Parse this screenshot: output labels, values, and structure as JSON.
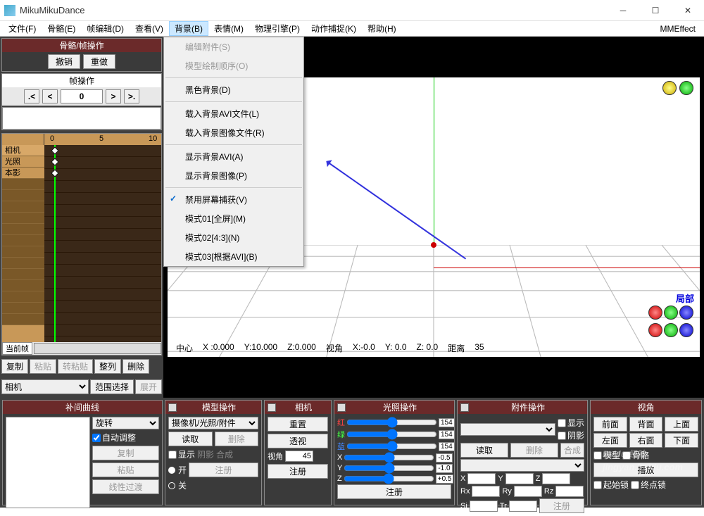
{
  "window": {
    "title": "MikuMikuDance"
  },
  "menubar": {
    "items": [
      "文件(F)",
      "骨骼(E)",
      "帧编辑(D)",
      "查看(V)",
      "背景(B)",
      "表情(M)",
      "物理引擎(P)",
      "动作捕捉(K)",
      "帮助(H)"
    ],
    "active_index": 4,
    "right": "MMEffect"
  },
  "dropdown": {
    "items": [
      {
        "label": "编辑附件(S)",
        "disabled": true
      },
      {
        "label": "模型绘制顺序(O)",
        "disabled": true
      },
      {
        "sep": true
      },
      {
        "label": "黑色背景(D)"
      },
      {
        "sep": true
      },
      {
        "label": "载入背景AVI文件(L)"
      },
      {
        "label": "载入背景图像文件(R)"
      },
      {
        "sep": true
      },
      {
        "label": "显示背景AVI(A)"
      },
      {
        "label": "显示背景图像(P)"
      },
      {
        "sep": true
      },
      {
        "label": "禁用屏幕捕获(V)",
        "checked": true
      },
      {
        "label": "模式01[全屏](M)"
      },
      {
        "label": "模式02[4:3](N)"
      },
      {
        "label": "模式03[根据AVI](B)"
      }
    ]
  },
  "bone_panel": {
    "title": "骨骼/帧操作",
    "undo": "撤销",
    "redo": "重做"
  },
  "frame_panel": {
    "title": "帧操作",
    "value": "0",
    "first": "|<",
    "prev": "<",
    "next": ">",
    "last": ">|"
  },
  "timeline": {
    "ruler": [
      "0",
      "5",
      "10"
    ],
    "tracks": [
      "相机",
      "光照",
      "本影"
    ],
    "current_label": "当前帧"
  },
  "ops": {
    "copy": "复制",
    "paste": "粘贴",
    "paste_rev": "转粘贴",
    "align": "整列",
    "delete": "删除",
    "model_select": "相机",
    "range": "范围选择",
    "expand": "展开"
  },
  "viewport": {
    "info": {
      "center": "中心",
      "x": "X :0.000",
      "y": "Y:10.000",
      "z": "Z:0.000",
      "view": "视角",
      "vx": "X:-0.0",
      "vy": "Y: 0.0",
      "vz": "Z: 0.0",
      "dist": "距离",
      "dval": "35"
    },
    "local": "局部"
  },
  "bottom": {
    "curve": {
      "title": "补间曲线",
      "mode": "旋转",
      "auto": "自动调整",
      "copy": "复制",
      "paste": "粘贴",
      "linear": "线性过渡"
    },
    "model": {
      "title": "模型操作",
      "select": "摄像机/光照/附件",
      "read": "读取",
      "delete": "删除",
      "show": "显示",
      "shadow": "阴影",
      "compose": "合成",
      "on": "开",
      "off": "关",
      "register": "注册"
    },
    "camera": {
      "title": "相机",
      "reset": "重置",
      "persp": "透视",
      "angle_label": "视角",
      "angle": "45",
      "register": "注册"
    },
    "light": {
      "title": "光照操作",
      "r": "红",
      "g": "绿",
      "b": "蓝",
      "rv": "154",
      "gv": "154",
      "bv": "154",
      "x": "X",
      "y": "Y",
      "z": "Z",
      "xv": "-0.5",
      "yv": "-1.0",
      "zv": "+0.5",
      "register": "注册"
    },
    "acc": {
      "title": "附件操作",
      "read": "读取",
      "delete": "删除",
      "show_label": "显示",
      "shadow": "阴影",
      "compose": "合成",
      "x": "X",
      "y": "Y",
      "z": "Z",
      "rx": "Rx",
      "ry": "Ry",
      "rz": "Rz",
      "si": "Si",
      "tr": "Tr",
      "register": "注册"
    },
    "view": {
      "title": "视角",
      "front": "前面",
      "back": "背面",
      "top": "上面",
      "left": "左面",
      "right": "右面",
      "bottom": "下面",
      "model": "模型",
      "bone": "骨骼",
      "play": "播放",
      "lock1": "起始锁",
      "lock2": "终点锁"
    }
  },
  "watermark": {
    "main": "Baidu 经验",
    "sub": "jingyan.baidu.com"
  }
}
